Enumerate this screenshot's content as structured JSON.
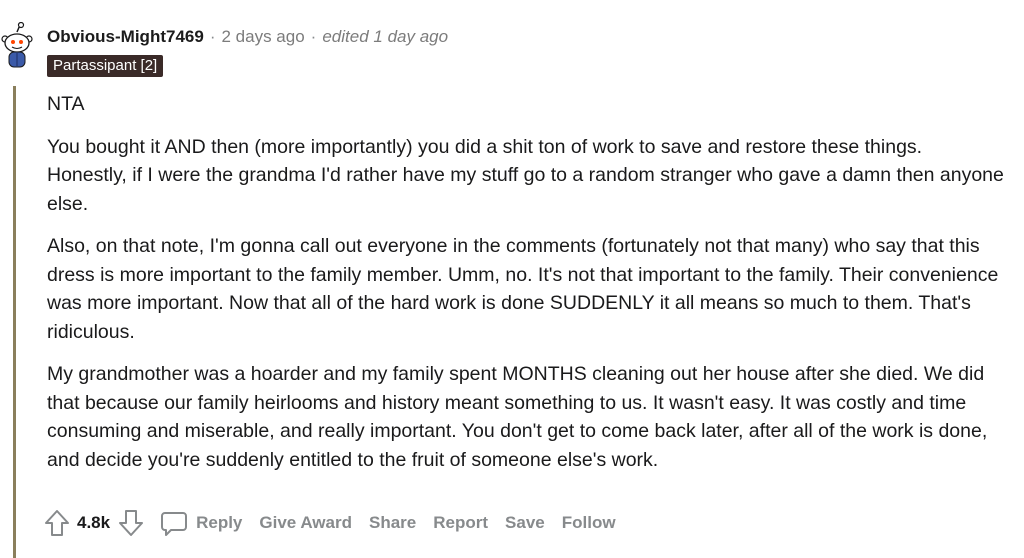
{
  "comment": {
    "author": "Obvious-Might7469",
    "separator": "·",
    "posted": "2 days ago",
    "edited": "edited 1 day ago",
    "flair": "Partassipant [2]",
    "paragraphs": [
      "NTA",
      "You bought it AND then (more importantly) you did a shit ton of work to save and restore these things. Honestly, if I were the grandma I'd rather have my stuff go to a random stranger who gave a damn then anyone else.",
      "Also, on that note, I'm gonna call out everyone in the comments (fortunately not that many) who say that this dress is more important to the family member. Umm, no. It's not that important to the family. Their convenience was more important. Now that all of the hard work is done SUDDENLY it all means so much to them. That's ridiculous.",
      "My grandmother was a hoarder and my family spent MONTHS cleaning out her house after she died. We did that because our family heirlooms and history meant something to us. It wasn't easy. It was costly and time consuming and miserable, and really important. You don't get to come back later, after all of the work is done, and decide you're suddenly entitled to the fruit of someone else's work."
    ],
    "score": "4.8k"
  },
  "actions": {
    "reply": "Reply",
    "give_award": "Give Award",
    "share": "Share",
    "report": "Report",
    "save": "Save",
    "follow": "Follow"
  },
  "icons": {
    "avatar": "snoo-avatar-icon",
    "upvote": "upvote-arrow-icon",
    "downvote": "downvote-arrow-icon",
    "reply": "comment-bubble-icon"
  },
  "colors": {
    "thread_line": "#8a7f5c",
    "flair_bg": "#3a2a28",
    "muted": "#878a8c"
  }
}
